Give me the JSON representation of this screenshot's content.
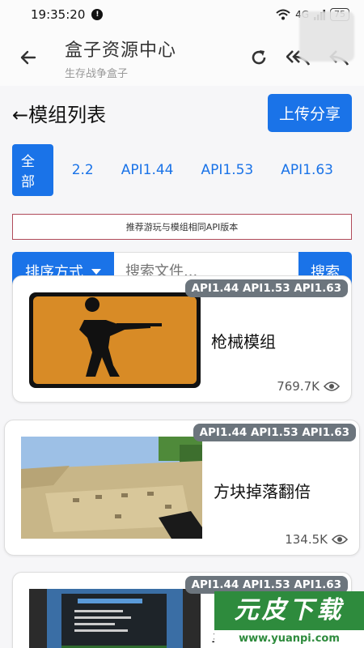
{
  "status": {
    "time": "19:35:20",
    "notif": "!",
    "signal": "4G",
    "battery": "75"
  },
  "appbar": {
    "title": "盒子资源中心",
    "subtitle": "生存战争盒子"
  },
  "header": {
    "title": "←模组列表",
    "upload": "上传分享"
  },
  "tabs": [
    "全部",
    "2.2",
    "API1.44",
    "API1.53",
    "API1.63"
  ],
  "notice": "推荐游玩与模组相同API版本",
  "search": {
    "sort_label": "排序方式",
    "placeholder": "搜索文件...",
    "button": "搜索"
  },
  "cards": [
    {
      "api": "API1.44 API1.53 API1.63",
      "title": "枪械模组",
      "views": "769.7K"
    },
    {
      "api": "API1.44 API1.53 API1.63",
      "title": "方块掉落翻倍",
      "views": "134.5K"
    },
    {
      "api": "API1.44 API1.53 API1.63",
      "title": "寻",
      "views": ""
    }
  ],
  "watermark": {
    "text": "元皮下载",
    "url": "www.yuanpi.com"
  },
  "colors": {
    "accent": "#1a73e8",
    "badge": "#6c757d",
    "notice_border": "#b04a5a"
  }
}
